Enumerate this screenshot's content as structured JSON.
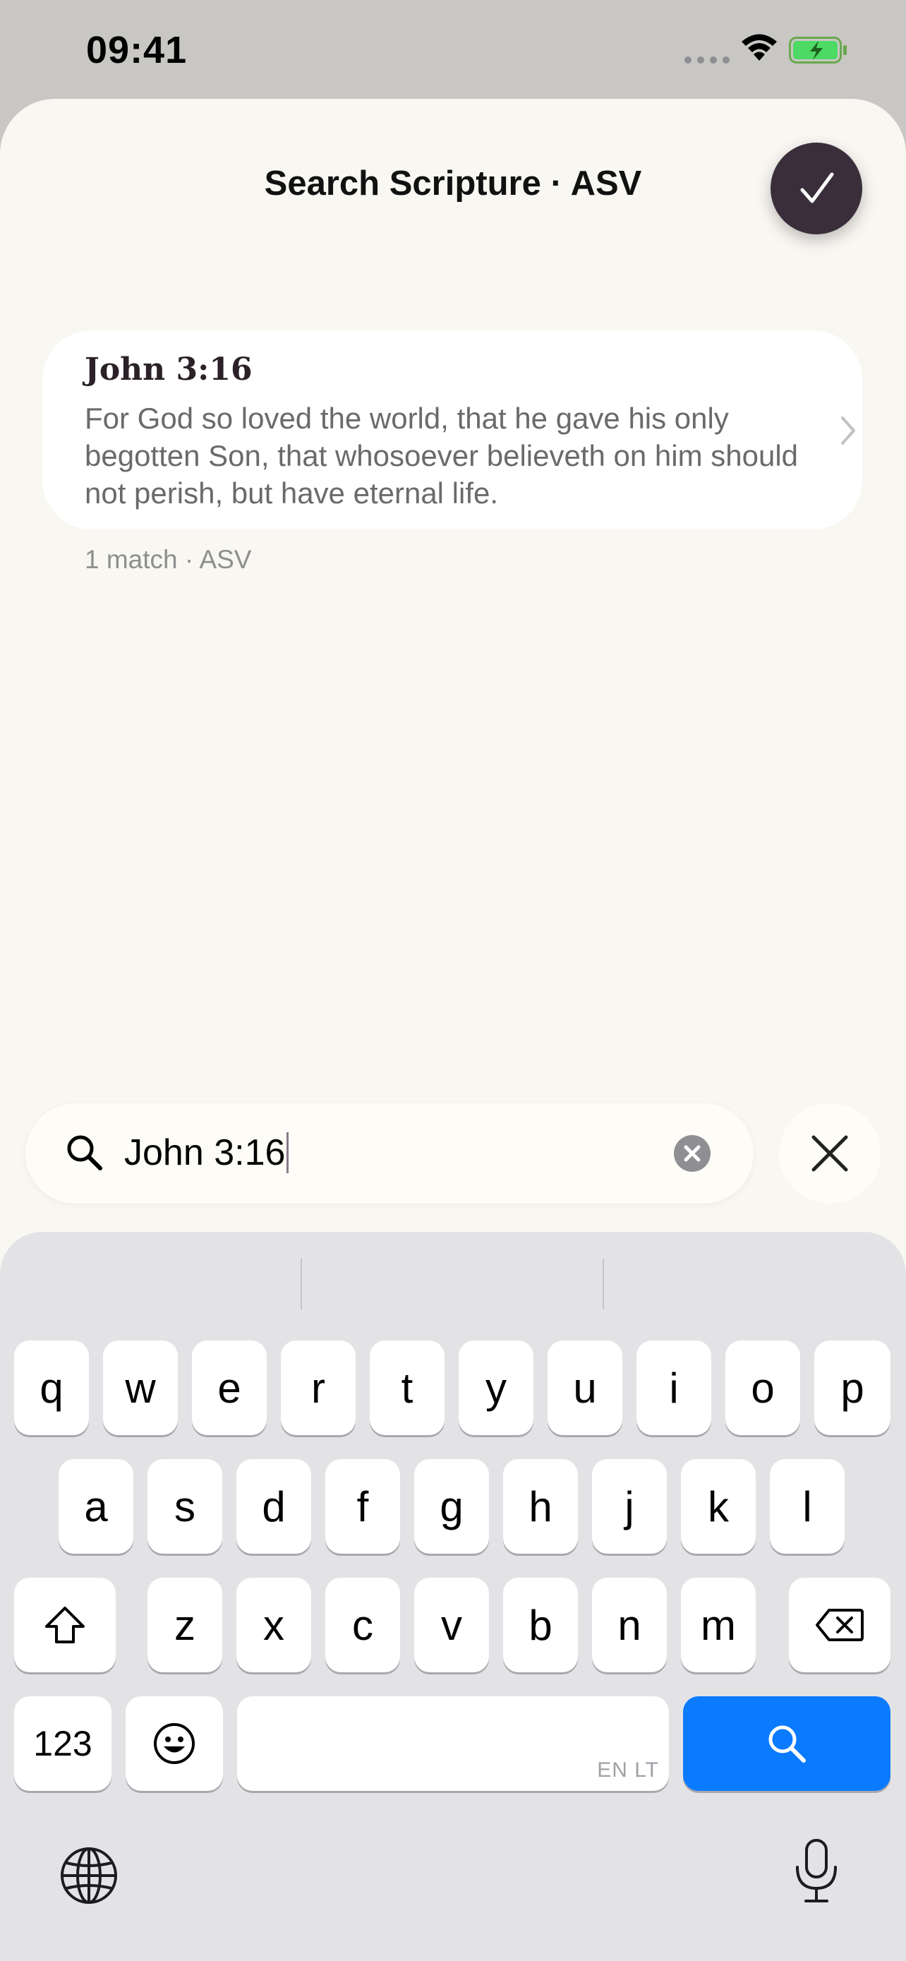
{
  "status_bar": {
    "time": "09:41"
  },
  "sheet": {
    "title": "Search Scripture · ASV"
  },
  "results": [
    {
      "reference": "John 3:16",
      "text": "For God so loved the world, that he gave his only begotten Son, that whosoever believeth on him should not perish, but have eternal life."
    }
  ],
  "match_count": "1 match · ASV",
  "search": {
    "value": "John 3:16"
  },
  "keyboard": {
    "row1": [
      "q",
      "w",
      "e",
      "r",
      "t",
      "y",
      "u",
      "i",
      "o",
      "p"
    ],
    "row2": [
      "a",
      "s",
      "d",
      "f",
      "g",
      "h",
      "j",
      "k",
      "l"
    ],
    "row3": [
      "z",
      "x",
      "c",
      "v",
      "b",
      "n",
      "m"
    ],
    "numbers_label": "123",
    "space_hint": "EN LT"
  },
  "colors": {
    "accent": "#0a7bff",
    "done_button": "#3a2e3a",
    "sheet_bg": "#f9f7f2"
  }
}
